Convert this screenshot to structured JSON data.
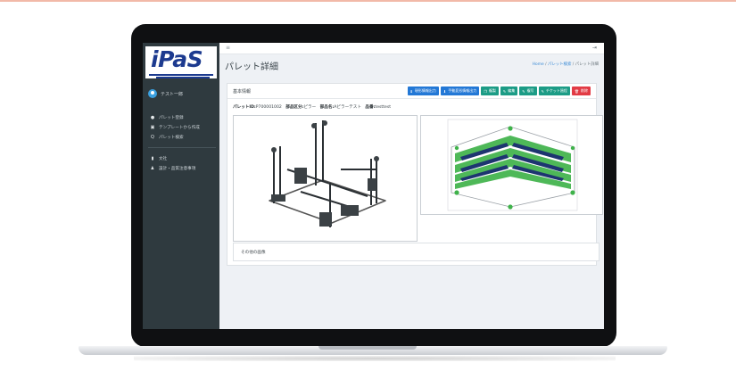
{
  "sidebar": {
    "logo_text": "iPaS",
    "user_name": "テスト一郎",
    "items": [
      {
        "label": "パレット登録",
        "icon": "plus-circle-icon"
      },
      {
        "label": "テンプレートから作成",
        "icon": "copy-icon"
      },
      {
        "label": "パレット検索",
        "icon": "search-icon"
      },
      {
        "label": "文社",
        "icon": "building-icon"
      },
      {
        "label": "設計・品質注意事項",
        "icon": "user-icon"
      }
    ]
  },
  "header": {
    "title": "パレット詳細",
    "breadcrumb": {
      "home": "Home",
      "sep1": "/",
      "search": "パレット検索",
      "sep2": "/",
      "current": "パレット詳細"
    }
  },
  "card": {
    "title": "基本情報",
    "buttons": [
      {
        "label": "現形情報出力",
        "color": "#2378d6"
      },
      {
        "label": "手動変形情報出力",
        "color": "#2378d6"
      },
      {
        "label": "複製",
        "color": "#1c9c86"
      },
      {
        "label": "編集",
        "color": "#1c9c86"
      },
      {
        "label": "複写",
        "color": "#1c9c86"
      },
      {
        "label": "チケット過程",
        "color": "#1c9c86"
      },
      {
        "label": "削除",
        "color": "#e23b45"
      }
    ],
    "meta": {
      "id_label": "パレットID:",
      "id_value": "P700001002",
      "category_label": "部品区分:",
      "category_value": "ピラー",
      "part_label": "部品名:",
      "part_value": "Aピラーテスト",
      "product_label": "品番:",
      "product_value": "testtest"
    },
    "other_images_label": "その他の画像"
  },
  "colors": {
    "accent": "#2378d6",
    "teal": "#1c9c86",
    "danger": "#e23b45",
    "sidebar": "#2f3a3f",
    "model_green": "#3fb24a",
    "model_navy": "#1d3570"
  }
}
